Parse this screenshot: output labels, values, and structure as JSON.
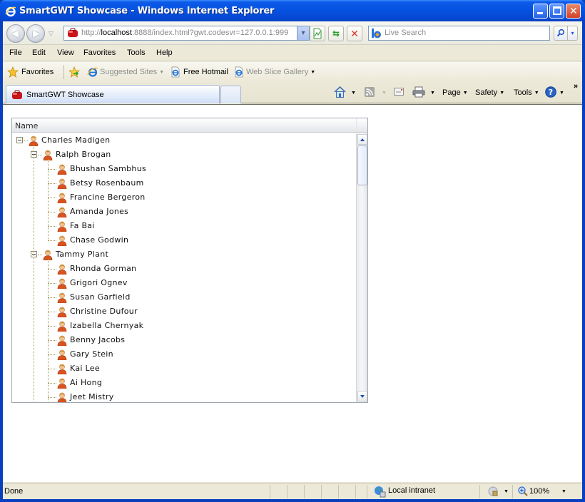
{
  "window": {
    "title": "SmartGWT Showcase - Windows Internet Explorer",
    "controls": {
      "minimize": "_",
      "maximize": "□",
      "close": "✕"
    }
  },
  "address_bar": {
    "url_prefix": "http://",
    "url_host": "localhost",
    "url_rest": ":8888/index.html?gwt.codesvr=127.0.0.1:999",
    "dropdown_glyph": "▾"
  },
  "search": {
    "placeholder": "Live Search",
    "go_glyph": "⚲",
    "dropdown_glyph": "▾"
  },
  "menu": [
    "File",
    "Edit",
    "View",
    "Favorites",
    "Tools",
    "Help"
  ],
  "favorites_bar": {
    "favorites_label": "Favorites",
    "items": [
      {
        "label": "Suggested Sites",
        "dim": true,
        "has_dropdown": true
      },
      {
        "label": "Free Hotmail",
        "dim": false,
        "has_dropdown": false
      },
      {
        "label": "Web Slice Gallery",
        "dim": true,
        "has_dropdown": true
      }
    ]
  },
  "tabs": [
    {
      "label": "SmartGWT Showcase",
      "active": true
    }
  ],
  "command_bar": {
    "page_label": "Page",
    "safety_label": "Safety",
    "tools_label": "Tools",
    "overflow_glyph": "»"
  },
  "tree_grid": {
    "header": "Name",
    "rows": [
      {
        "name": "Charles Madigen",
        "depth": 0,
        "expanded": true
      },
      {
        "name": "Ralph Brogan",
        "depth": 1,
        "expanded": true
      },
      {
        "name": "Bhushan Sambhus",
        "depth": 2
      },
      {
        "name": "Betsy Rosenbaum",
        "depth": 2
      },
      {
        "name": "Francine Bergeron",
        "depth": 2
      },
      {
        "name": "Amanda Jones",
        "depth": 2
      },
      {
        "name": "Fa Bai",
        "depth": 2
      },
      {
        "name": "Chase Godwin",
        "depth": 2
      },
      {
        "name": "Tammy Plant",
        "depth": 1,
        "expanded": true
      },
      {
        "name": "Rhonda Gorman",
        "depth": 2
      },
      {
        "name": "Grigori Ognev",
        "depth": 2
      },
      {
        "name": "Susan Garfield",
        "depth": 2
      },
      {
        "name": "Christine Dufour",
        "depth": 2
      },
      {
        "name": "Izabella Chernyak",
        "depth": 2
      },
      {
        "name": "Benny Jacobs",
        "depth": 2
      },
      {
        "name": "Gary Stein",
        "depth": 2
      },
      {
        "name": "Kai Lee",
        "depth": 2
      },
      {
        "name": "Ai Hong",
        "depth": 2
      },
      {
        "name": "Jeet Mistry",
        "depth": 2
      }
    ]
  },
  "status_bar": {
    "status": "Done",
    "zone": "Local intranet",
    "zoom": "100%"
  }
}
